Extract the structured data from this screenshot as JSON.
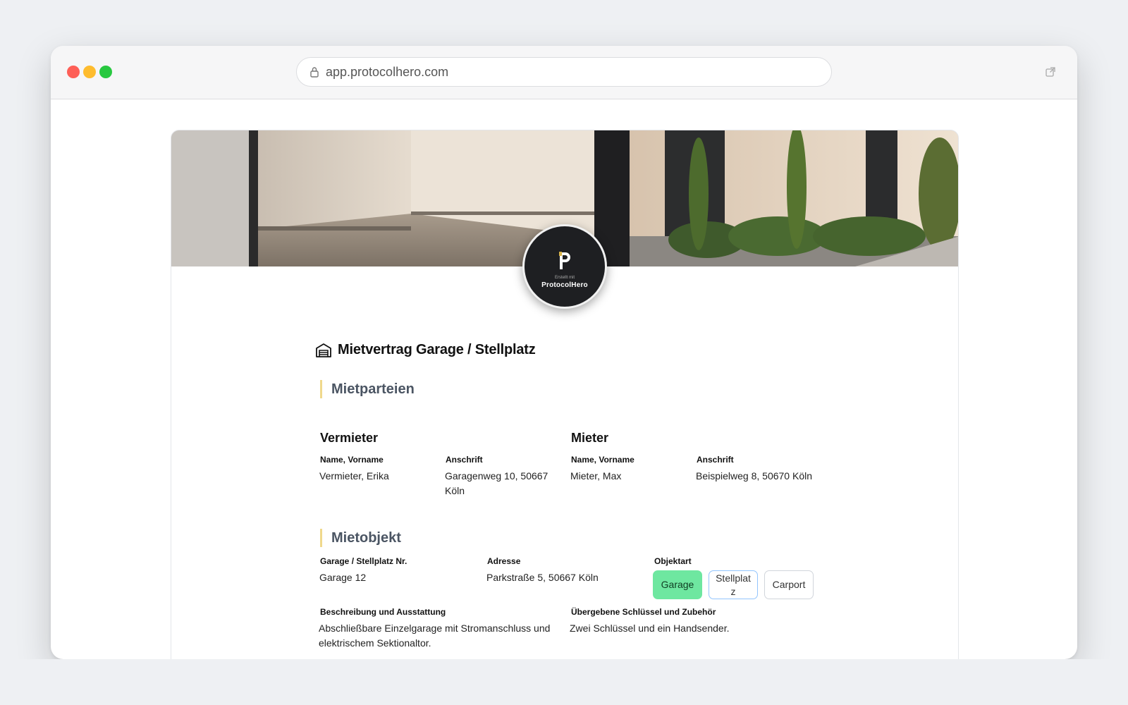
{
  "browser": {
    "url": "app.protocolhero.com"
  },
  "logo": {
    "created_with": "Erstellt mit",
    "brand": "ProtocolHero"
  },
  "document": {
    "title": "Mietvertrag Garage / Stellplatz"
  },
  "sections": {
    "parties": {
      "heading": "Mietparteien",
      "landlord": {
        "title": "Vermieter",
        "name_label": "Name, Vorname",
        "name_value": "Vermieter, Erika",
        "address_label": "Anschrift",
        "address_value": "Garagenweg 10, 50667 Köln"
      },
      "tenant": {
        "title": "Mieter",
        "name_label": "Name, Vorname",
        "name_value": "Mieter, Max",
        "address_label": "Anschrift",
        "address_value": "Beispielweg 8, 50670 Köln"
      }
    },
    "object": {
      "heading": "Mietobjekt",
      "number_label": "Garage / Stellplatz Nr.",
      "number_value": "Garage 12",
      "address_label": "Adresse",
      "address_value": "Parkstraße 5, 50667 Köln",
      "type_label": "Objektart",
      "type_options": [
        "Garage",
        "Stellplatz",
        "Carport"
      ],
      "type_selected": "Garage",
      "description_label": "Beschreibung und Ausstattung",
      "description_value": "Abschließbare Einzelgarage mit Stromanschluss und elektrischem Sektionaltor.",
      "keys_label": "Übergebene Schlüssel und Zubehör",
      "keys_value": "Zwei Schlüssel und ein Handsender."
    }
  },
  "colors": {
    "accent_bar": "#f0d98c",
    "selected_chip": "#6ee7a0",
    "chip_outline": "#93c5fd"
  },
  "icons": {
    "lock": "lock-icon",
    "external": "external-link-icon",
    "garage": "garage-icon",
    "logo": "protocolhero-logo-icon"
  }
}
